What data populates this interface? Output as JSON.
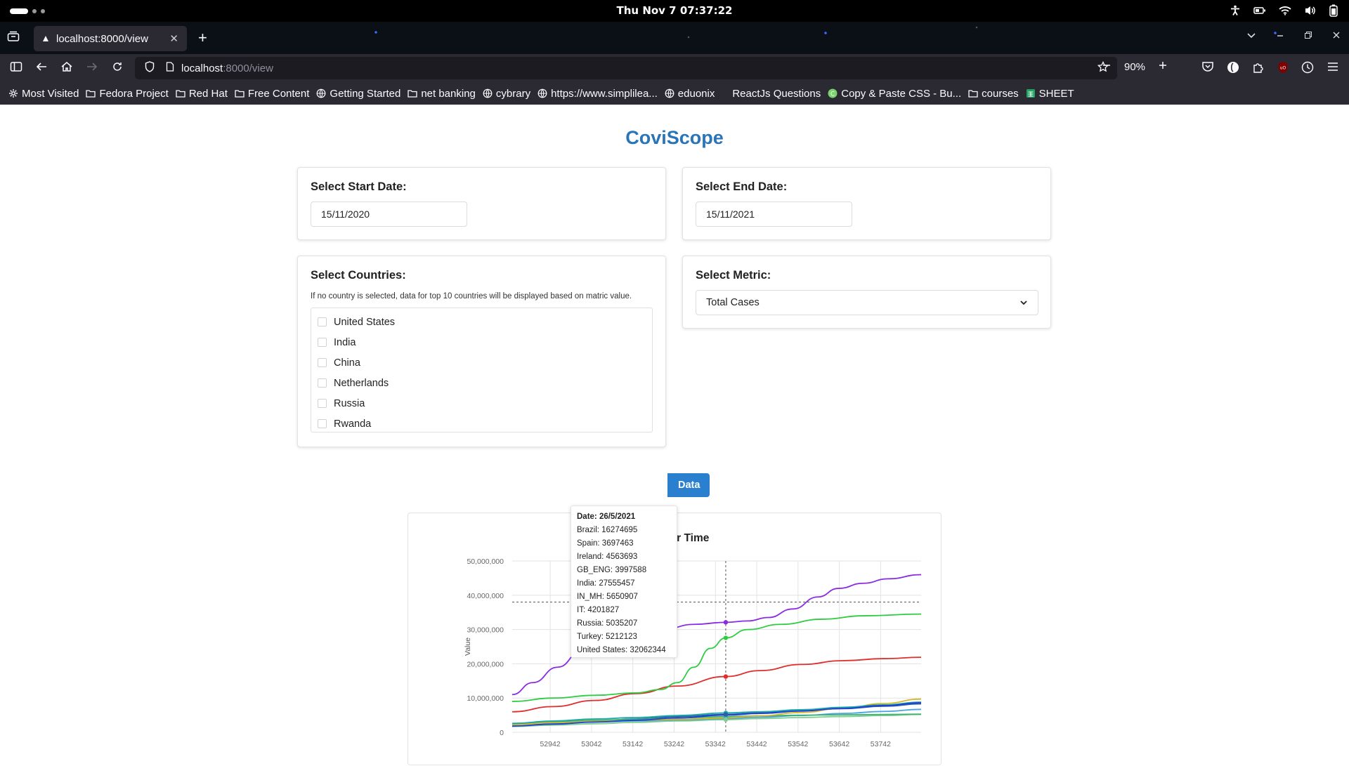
{
  "system": {
    "clock": "Thu Nov 7  07:37:22"
  },
  "browser": {
    "tab_title": "localhost:8000/view",
    "url_host": "localhost",
    "url_path": ":8000/view",
    "zoom": "90%",
    "bookmarks": [
      {
        "label": "Most Visited",
        "icon": "gear-icon"
      },
      {
        "label": "Fedora Project",
        "icon": "folder-icon"
      },
      {
        "label": "Red Hat",
        "icon": "folder-icon"
      },
      {
        "label": "Free Content",
        "icon": "folder-icon"
      },
      {
        "label": "Getting Started",
        "icon": "globe-icon"
      },
      {
        "label": "net banking",
        "icon": "folder-icon"
      },
      {
        "label": "cybrary",
        "icon": "globe-icon"
      },
      {
        "label": "https://www.simplilea...",
        "icon": "globe-icon"
      },
      {
        "label": "eduonix",
        "icon": "globe-icon"
      },
      {
        "label": "ReactJs Questions",
        "icon": "blank-icon"
      },
      {
        "label": "Copy & Paste CSS - Bu...",
        "icon": "copy-css-icon"
      },
      {
        "label": "courses",
        "icon": "folder-icon"
      },
      {
        "label": "SHEET",
        "icon": "sheets-icon"
      }
    ]
  },
  "app": {
    "title": "CoviScope",
    "start_date": {
      "label": "Select Start Date:",
      "value": "15/11/2020"
    },
    "end_date": {
      "label": "Select End Date:",
      "value": "15/11/2021"
    },
    "countries": {
      "label": "Select Countries:",
      "hint": "If no country is selected, data for top 10 countries will be displayed based on matric value.",
      "items": [
        "United States",
        "India",
        "China",
        "Netherlands",
        "Russia",
        "Rwanda"
      ]
    },
    "metric": {
      "label": "Select Metric:",
      "value": "Total Cases"
    },
    "fetch_button": "Data",
    "chart_title": "ric Over Time"
  },
  "tooltip": {
    "date": "Date: 26/5/2021",
    "rows": [
      "Brazil: 16274695",
      "Spain: 3697463",
      "Ireland: 4563693",
      "GB_ENG: 3997588",
      "India: 27555457",
      "IN_MH: 5650907",
      "IT: 4201827",
      "Russia: 5035207",
      "Turkey: 5212123",
      "United States: 32062344"
    ]
  },
  "chart_data": {
    "type": "line",
    "ylabel": "Value",
    "ylim": [
      0,
      50000000
    ],
    "y_ticks": [
      "0",
      "10,000,000",
      "20,000,000",
      "30,000,000",
      "40,000,000",
      "50,000,000"
    ],
    "x_ticks": [
      "52942",
      "53042",
      "53142",
      "53242",
      "53342",
      "53442",
      "53542",
      "53642",
      "53742"
    ],
    "xlim": [
      52850,
      53840
    ],
    "hover_x": 53367,
    "hover_y": 38000000,
    "grid": true,
    "series": [
      {
        "color": "#8a2be2",
        "x": [
          52850,
          52900,
          52960,
          53020,
          53080,
          53150,
          53220,
          53290,
          53367,
          53420,
          53470,
          53530,
          53590,
          53640,
          53700,
          53760,
          53840
        ],
        "y": [
          11000000,
          14500000,
          19000000,
          24000000,
          27000000,
          28800000,
          30200000,
          31500000,
          32100000,
          32500000,
          33500000,
          36000000,
          39500000,
          42000000,
          43500000,
          44800000,
          46000000
        ]
      },
      {
        "color": "#2ecc40",
        "x": [
          52850,
          52950,
          53050,
          53150,
          53210,
          53250,
          53290,
          53330,
          53367,
          53420,
          53500,
          53600,
          53700,
          53840
        ],
        "y": [
          9000000,
          10000000,
          10800000,
          11500000,
          12500000,
          14500000,
          19000000,
          24500000,
          27555457,
          30000000,
          31500000,
          33000000,
          34000000,
          34500000
        ]
      },
      {
        "color": "#e02d2d",
        "x": [
          52850,
          52950,
          53050,
          53150,
          53250,
          53367,
          53450,
          53550,
          53650,
          53750,
          53840
        ],
        "y": [
          6000000,
          7500000,
          9300000,
          11300000,
          13500000,
          16274695,
          18000000,
          19800000,
          20900000,
          21500000,
          21900000
        ]
      },
      {
        "color": "#1f3fd6",
        "x": [
          52850,
          52950,
          53050,
          53150,
          53250,
          53367,
          53450,
          53550,
          53650,
          53750,
          53840
        ],
        "y": [
          1800000,
          2400000,
          3000000,
          3500000,
          4200000,
          5035207,
          5500000,
          6200000,
          7000000,
          7800000,
          8600000
        ]
      },
      {
        "color": "#1aa8a8",
        "x": [
          52850,
          52950,
          53050,
          53150,
          53250,
          53367,
          53450,
          53550,
          53650,
          53750,
          53840
        ],
        "y": [
          2600000,
          3300000,
          3900000,
          4300000,
          4900000,
          5650907,
          6000000,
          6600000,
          7300000,
          8000000,
          8800000
        ]
      },
      {
        "color": "#d4b82a",
        "x": [
          52850,
          52950,
          53050,
          53150,
          53250,
          53367,
          53450,
          53550,
          53650,
          53750,
          53840
        ],
        "y": [
          2200000,
          2800000,
          3200000,
          3500000,
          3800000,
          4201827,
          4800000,
          5800000,
          7000000,
          8400000,
          9700000
        ]
      },
      {
        "color": "#3cb371",
        "x": [
          52850,
          52950,
          53050,
          53150,
          53250,
          53367,
          53450,
          53550,
          53650,
          53750,
          53840
        ],
        "y": [
          2300000,
          3000000,
          3500000,
          3800000,
          4200000,
          4563693,
          4800000,
          5000000,
          5100000,
          5200000,
          5300000
        ]
      },
      {
        "color": "#4aa3df",
        "x": [
          52850,
          52950,
          53050,
          53150,
          53250,
          53367,
          53450,
          53550,
          53650,
          53750,
          53840
        ],
        "y": [
          2000000,
          2600000,
          3000000,
          3300000,
          3600000,
          3997588,
          4400000,
          4900000,
          5500000,
          6100000,
          6700000
        ]
      },
      {
        "color": "#7ecf8e",
        "x": [
          52850,
          52950,
          53050,
          53150,
          53250,
          53367,
          53450,
          53550,
          53650,
          53750,
          53840
        ],
        "y": [
          1700000,
          2100000,
          2500000,
          2900000,
          3300000,
          3697463,
          4000000,
          4300000,
          4600000,
          4900000,
          5200000
        ]
      },
      {
        "color": "#2b5fa8",
        "x": [
          52850,
          52950,
          53050,
          53150,
          53250,
          53367,
          53450,
          53550,
          53650,
          53750,
          53840
        ],
        "y": [
          2100000,
          2700000,
          3300000,
          3900000,
          4600000,
          5212123,
          5700000,
          6300000,
          6900000,
          7600000,
          8300000
        ]
      }
    ]
  }
}
